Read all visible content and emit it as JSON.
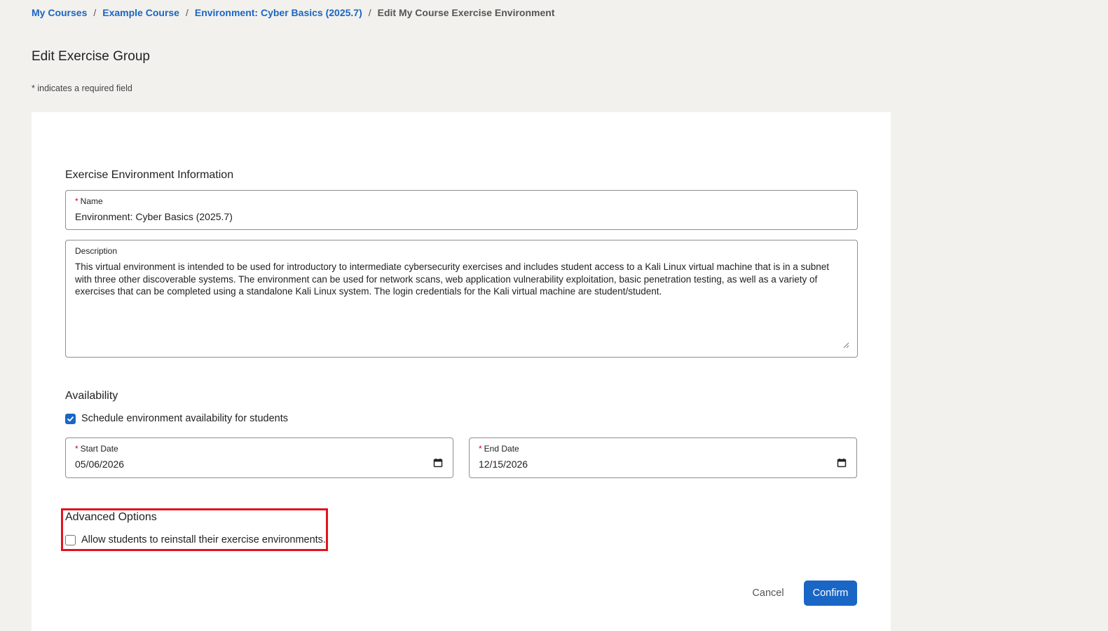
{
  "breadcrumb": {
    "items": [
      "My Courses",
      "Example Course",
      "Environment: Cyber Basics (2025.7)"
    ],
    "current": "Edit My Course Exercise Environment",
    "separator": "/"
  },
  "page": {
    "title": "Edit Exercise Group",
    "required_note": "* indicates a required field"
  },
  "info": {
    "section_title": "Exercise Environment Information",
    "name_label": "Name",
    "name_value": "Environment: Cyber Basics (2025.7)",
    "description_label": "Description",
    "description_value": "This virtual environment is intended to be used for introductory to intermediate cybersecurity exercises and includes student access to a Kali Linux virtual machine that is in a subnet with three other discoverable systems. The environment can be used for network scans, web application vulnerability exploitation, basic penetration testing, as well as a variety of exercises that can be completed using a standalone Kali Linux system. The login credentials for the Kali virtual machine are student/student."
  },
  "availability": {
    "section_title": "Availability",
    "schedule_label": "Schedule environment availability for students",
    "schedule_checked": true,
    "start_label": "Start Date",
    "start_value": "05/06/2026",
    "end_label": "End Date",
    "end_value": "12/15/2026"
  },
  "advanced": {
    "section_title": "Advanced Options",
    "reinstall_label": "Allow students to reinstall their exercise environments.",
    "reinstall_checked": false
  },
  "actions": {
    "cancel_label": "Cancel",
    "confirm_label": "Confirm"
  },
  "colors": {
    "accent": "#1a66c4",
    "highlight": "#e0141e",
    "background": "#f2f1ed",
    "required_star": "#d0021b"
  },
  "icons": {
    "calendar": "calendar-icon",
    "check": "checkmark-icon",
    "resize": "resize-grip-icon"
  }
}
